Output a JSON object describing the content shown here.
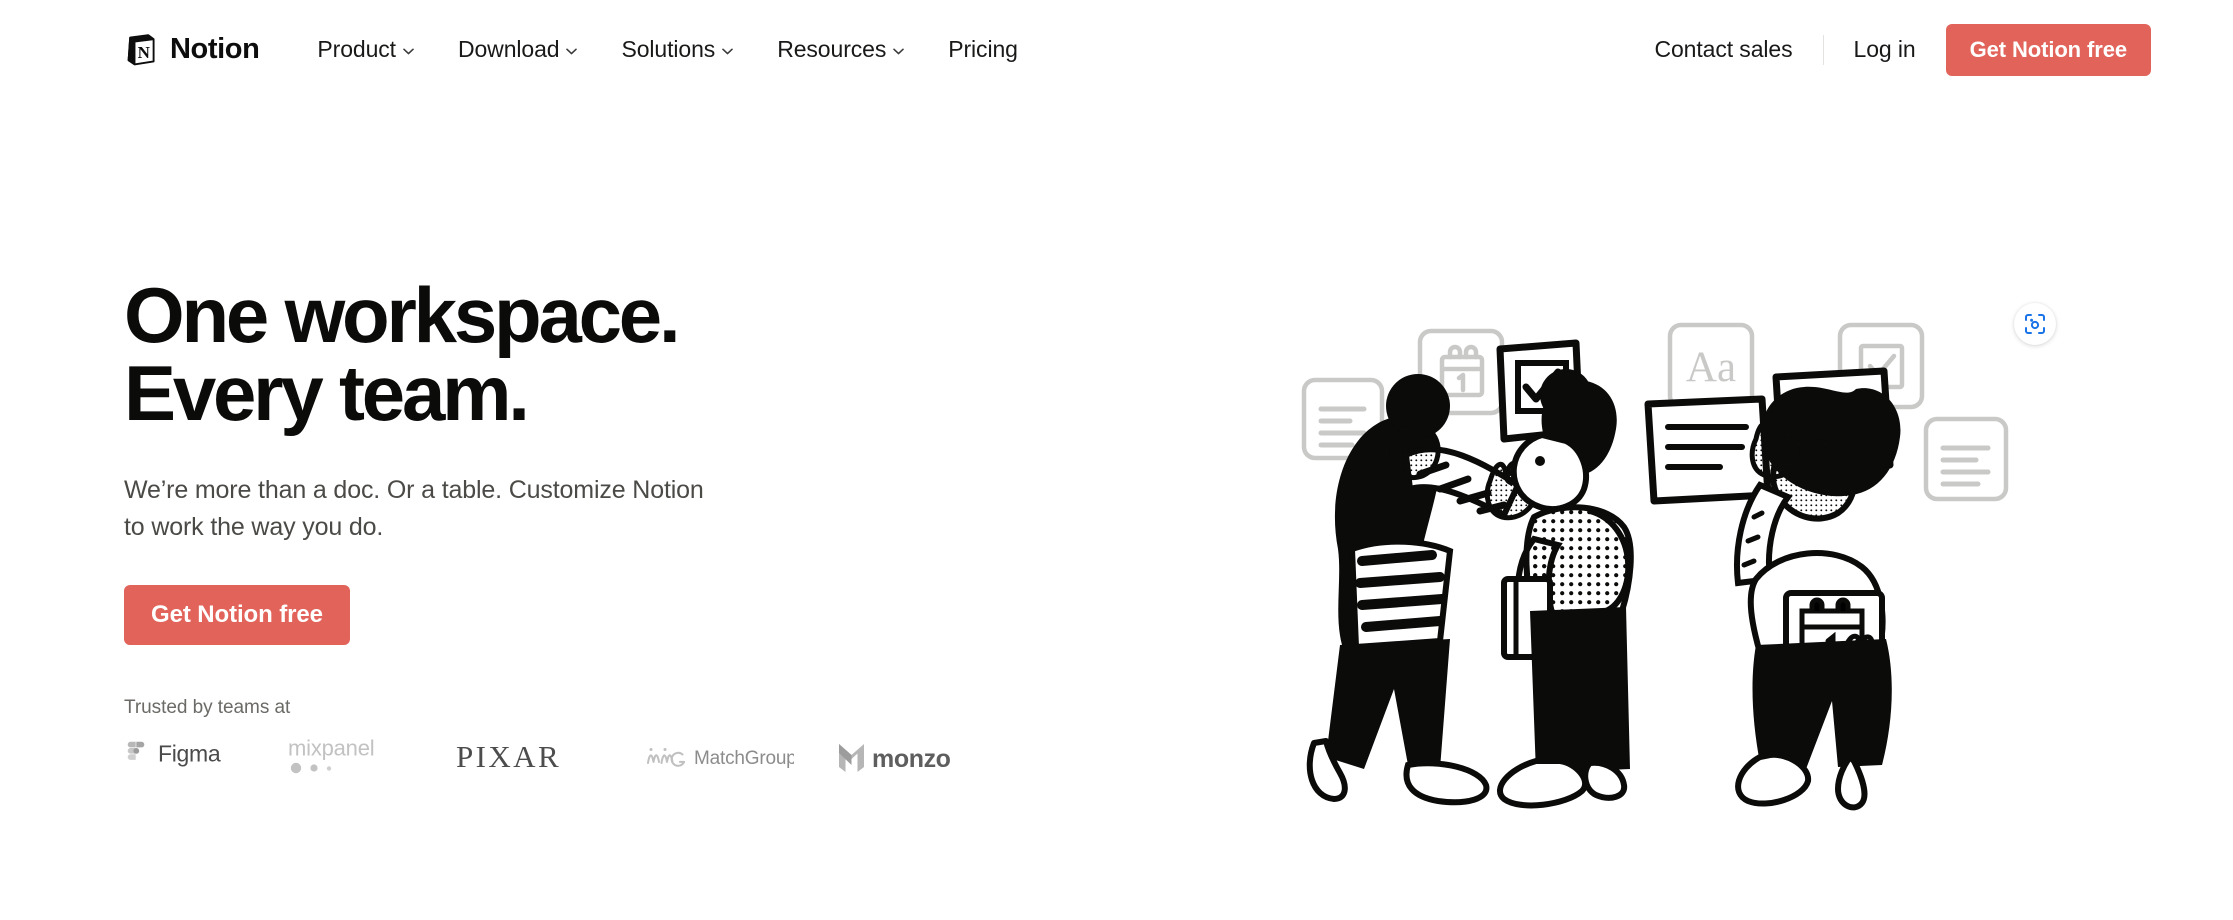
{
  "brand": {
    "name": "Notion",
    "logo_icon": "notion-cube-icon"
  },
  "header": {
    "nav_items": [
      {
        "label": "Product",
        "has_dropdown": true,
        "icon": "chevron-down-icon"
      },
      {
        "label": "Download",
        "has_dropdown": true,
        "icon": "chevron-down-icon"
      },
      {
        "label": "Solutions",
        "has_dropdown": true,
        "icon": "chevron-down-icon"
      },
      {
        "label": "Resources",
        "has_dropdown": true,
        "icon": "chevron-down-icon"
      },
      {
        "label": "Pricing",
        "has_dropdown": false,
        "icon": ""
      }
    ],
    "contact_sales": "Contact sales",
    "log_in": "Log in",
    "cta": "Get Notion free"
  },
  "hero": {
    "title_line1": "One workspace.",
    "title_line2": "Every team.",
    "subtitle": "We’re more than a doc. Or a table. Customize Notion to work the way you do.",
    "cta": "Get Notion free",
    "trusted_label": "Trusted by teams at",
    "logos": [
      {
        "name": "Figma",
        "icon": "figma-logo"
      },
      {
        "name": "mixpanel",
        "icon": "mixpanel-logo"
      },
      {
        "name": "PIXAR",
        "icon": "pixar-logo"
      },
      {
        "name": "MatchGroup",
        "icon": "matchgroup-logo"
      },
      {
        "name": "monzo",
        "icon": "monzo-logo"
      }
    ],
    "illustration": {
      "alt": "Three illustrated people arranging document, checkbox, calendar and text cards on a wall",
      "cards": [
        {
          "icon": "document-lines-card-icon"
        },
        {
          "icon": "calendar-date-1-card-icon",
          "label": "1"
        },
        {
          "icon": "text-style-card-icon",
          "label": "Aa"
        },
        {
          "icon": "checkbox-checked-card-icon"
        },
        {
          "icon": "document-lines-card-icon"
        }
      ]
    }
  },
  "overlay": {
    "lens_button_icon": "google-lens-icon"
  },
  "colors": {
    "accent": "#e1635a",
    "text": "#0b0b0a",
    "muted_text": "#4b4a47",
    "subtle_text": "#6b6a66",
    "divider": "#e3e2e0",
    "card_outline": "#c9c9c7",
    "lens_blue": "#1a73e8",
    "background": "#ffffff"
  }
}
